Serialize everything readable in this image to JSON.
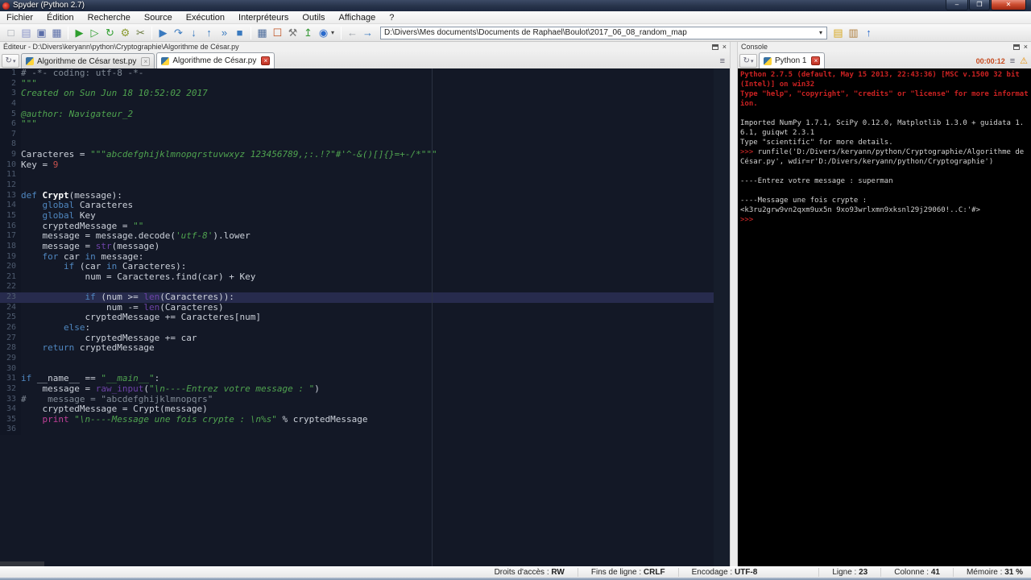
{
  "window": {
    "title": "Spyder (Python 2.7)",
    "controls": {
      "minimize": "–",
      "maximize": "❐",
      "close": "✕"
    }
  },
  "menu": {
    "items": [
      "Fichier",
      "Édition",
      "Recherche",
      "Source",
      "Exécution",
      "Interpréteurs",
      "Outils",
      "Affichage",
      "?"
    ]
  },
  "icons": {
    "close": "×",
    "caret": "▾",
    "browse": "↻",
    "options": "≡",
    "warning": "⚠"
  },
  "toolbar": {
    "path": "D:\\Divers\\Mes documents\\Documents de Raphael\\Boulot\\2017_06_08_random_map",
    "icons": [
      {
        "name": "new-file",
        "g": "□",
        "c": "#9aa0a8"
      },
      {
        "name": "open-file",
        "g": "▤",
        "c": "#8a94c8"
      },
      {
        "name": "save",
        "g": "▣",
        "c": "#5b6ea8"
      },
      {
        "name": "save-all",
        "g": "▦",
        "c": "#5b6ea8"
      },
      {
        "sep": true
      },
      {
        "name": "run",
        "g": "▶",
        "c": "#2f9e2f"
      },
      {
        "name": "run-cell",
        "g": "▷",
        "c": "#2f9e2f"
      },
      {
        "name": "re-run",
        "g": "↻",
        "c": "#2f9e2f"
      },
      {
        "name": "run-settings",
        "g": "⚙",
        "c": "#8a9a2f"
      },
      {
        "name": "profiler",
        "g": "✂",
        "c": "#6a7a3f"
      },
      {
        "sep": true
      },
      {
        "name": "debug",
        "g": "▶",
        "c": "#3a7abf"
      },
      {
        "name": "step-over",
        "g": "↷",
        "c": "#3a7abf"
      },
      {
        "name": "step-into",
        "g": "↓",
        "c": "#3a7abf"
      },
      {
        "name": "step-out",
        "g": "↑",
        "c": "#3a7abf"
      },
      {
        "name": "debug-continue",
        "g": "»",
        "c": "#3a7abf"
      },
      {
        "name": "debug-stop",
        "g": "■",
        "c": "#3a7abf"
      },
      {
        "sep": true
      },
      {
        "name": "panes",
        "g": "▦",
        "c": "#4a6a9a"
      },
      {
        "name": "fullscreen",
        "g": "☐",
        "c": "#c05020"
      },
      {
        "name": "preferences",
        "g": "⚒",
        "c": "#777777"
      },
      {
        "name": "pythonpath",
        "g": "↥",
        "c": "#3a9a3a"
      },
      {
        "name": "spyder-menu",
        "g": "◉",
        "c": "#2a6acc",
        "caret": true
      },
      {
        "sep": true
      },
      {
        "name": "back",
        "g": "←",
        "c": "#9aa0a8"
      },
      {
        "name": "forward",
        "g": "→",
        "c": "#3a7abf"
      }
    ],
    "right_icons": [
      {
        "name": "browse-directory",
        "g": "▤",
        "c": "#d8a820"
      },
      {
        "name": "set-console-directory",
        "g": "▥",
        "c": "#b08040"
      },
      {
        "name": "parent-directory",
        "g": "↑",
        "c": "#2a6acc"
      }
    ]
  },
  "editor": {
    "header": "Éditeur - D:\\Divers\\keryann\\python\\Cryptographie\\Algorithme de César.py",
    "tabs": [
      {
        "label": "Algorithme de César test.py",
        "active": false
      },
      {
        "label": "Algorithme de César.py",
        "active": true
      }
    ],
    "current_line": 23,
    "lines": [
      [
        [
          "cm",
          "# -*- coding: utf-8 -*-"
        ]
      ],
      [
        [
          "str",
          "\"\"\""
        ]
      ],
      [
        [
          "str",
          "Created on Sun Jun 18 10:52:02 2017"
        ]
      ],
      [],
      [
        [
          "str",
          "@author: Navigateur_2"
        ]
      ],
      [
        [
          "str",
          "\"\"\""
        ]
      ],
      [],
      [],
      [
        [
          "txt",
          "Caracteres = "
        ],
        [
          "str",
          "\"\"\"abcdefghijklmnopqrstuvwxyz 123456789,;:.!?\"#'^-&()[]{}=+-/*\"\"\""
        ]
      ],
      [
        [
          "txt",
          "Key = "
        ],
        [
          "num",
          "9"
        ]
      ],
      [],
      [],
      [
        [
          "kw",
          "def"
        ],
        [
          "txt",
          " "
        ],
        [
          "fn",
          "Crypt"
        ],
        [
          "txt",
          "(message):"
        ]
      ],
      [
        [
          "txt",
          "    "
        ],
        [
          "kw",
          "global"
        ],
        [
          "txt",
          " Caracteres"
        ]
      ],
      [
        [
          "txt",
          "    "
        ],
        [
          "kw",
          "global"
        ],
        [
          "txt",
          " Key"
        ]
      ],
      [
        [
          "txt",
          "    cryptedMessage = "
        ],
        [
          "str",
          "\"\""
        ]
      ],
      [
        [
          "txt",
          "    message = message.decode("
        ],
        [
          "str",
          "'utf-8'"
        ],
        [
          "txt",
          ").lower"
        ]
      ],
      [
        [
          "txt",
          "    message = "
        ],
        [
          "bi",
          "str"
        ],
        [
          "txt",
          "(message)"
        ]
      ],
      [
        [
          "txt",
          "    "
        ],
        [
          "kw",
          "for"
        ],
        [
          "txt",
          " car "
        ],
        [
          "kw",
          "in"
        ],
        [
          "txt",
          " message:"
        ]
      ],
      [
        [
          "txt",
          "        "
        ],
        [
          "kw",
          "if"
        ],
        [
          "txt",
          " (car "
        ],
        [
          "kw",
          "in"
        ],
        [
          "txt",
          " Caracteres):"
        ]
      ],
      [
        [
          "txt",
          "            num = Caracteres.find(car) + Key"
        ]
      ],
      [],
      [
        [
          "txt",
          "            "
        ],
        [
          "kw",
          "if"
        ],
        [
          "txt",
          " (num >= "
        ],
        [
          "bi",
          "len"
        ],
        [
          "txt",
          "(Caracteres)):"
        ]
      ],
      [
        [
          "txt",
          "                num -= "
        ],
        [
          "bi",
          "len"
        ],
        [
          "txt",
          "(Caracteres)"
        ]
      ],
      [
        [
          "txt",
          "            cryptedMessage += Caracteres[num]"
        ]
      ],
      [
        [
          "txt",
          "        "
        ],
        [
          "kw",
          "else"
        ],
        [
          "txt",
          ":"
        ]
      ],
      [
        [
          "txt",
          "            cryptedMessage += car"
        ]
      ],
      [
        [
          "txt",
          "    "
        ],
        [
          "kw",
          "return"
        ],
        [
          "txt",
          " cryptedMessage"
        ]
      ],
      [],
      [],
      [
        [
          "kw",
          "if"
        ],
        [
          "txt",
          " __name__ == "
        ],
        [
          "str",
          "\"__main__\""
        ],
        [
          "txt",
          ":"
        ]
      ],
      [
        [
          "txt",
          "    message = "
        ],
        [
          "bi",
          "raw_input"
        ],
        [
          "txt",
          "("
        ],
        [
          "str",
          "\"\\n----Entrez votre message : \""
        ],
        [
          "txt",
          ")"
        ]
      ],
      [
        [
          "cm",
          "#    message = \"abcdefghijklmnopqrs\""
        ]
      ],
      [
        [
          "txt",
          "    cryptedMessage = Crypt(message)"
        ]
      ],
      [
        [
          "txt",
          "    "
        ],
        [
          "pr",
          "print"
        ],
        [
          "txt",
          " "
        ],
        [
          "str",
          "\"\\n----Message une fois crypte : \\n%s\""
        ],
        [
          "txt",
          " % cryptedMessage"
        ]
      ],
      []
    ]
  },
  "console": {
    "header": "Console",
    "tab_label": "Python 1",
    "timer": "00:00:12",
    "lines": [
      [
        [
          "err",
          "Python 2.7.5 (default, May 15 2013, 22:43:36) [MSC v.1500 32 bit (Intel)] on win32"
        ]
      ],
      [
        [
          "err",
          "Type \"help\", \"copyright\", \"credits\" or \"license\" for more information."
        ]
      ],
      [],
      [
        [
          "out",
          "Imported NumPy 1.7.1, SciPy 0.12.0, Matplotlib 1.3.0 + guidata 1.6.1, guiqwt 2.3.1"
        ]
      ],
      [
        [
          "out",
          "Type \"scientific\" for more details."
        ]
      ],
      [
        [
          "prompt",
          ">>> "
        ],
        [
          "out",
          "runfile('D:/Divers/keryann/python/Cryptographie/Algorithme de César.py', wdir=r'D:/Divers/keryann/python/Cryptographie')"
        ]
      ],
      [],
      [
        [
          "out",
          "----Entrez votre message : superman"
        ]
      ],
      [],
      [
        [
          "out",
          "----Message une fois crypte :"
        ]
      ],
      [
        [
          "out",
          "<k3ru2grw9vn2qxm9ux5n 9xo93wrlxmn9xksnl29j29060!..C:'#>"
        ]
      ],
      [
        [
          "prompt",
          ">>>"
        ]
      ]
    ]
  },
  "statusbar": {
    "fields": [
      {
        "label": "Droits d'accès : ",
        "value": "RW"
      },
      {
        "label": "Fins de ligne : ",
        "value": "CRLF"
      },
      {
        "label": "Encodage : ",
        "value": "UTF-8"
      },
      {
        "label": "Ligne : ",
        "value": "23"
      },
      {
        "label": "Colonne : ",
        "value": "41"
      },
      {
        "label": "Mémoire : ",
        "value": "31 %"
      }
    ]
  }
}
